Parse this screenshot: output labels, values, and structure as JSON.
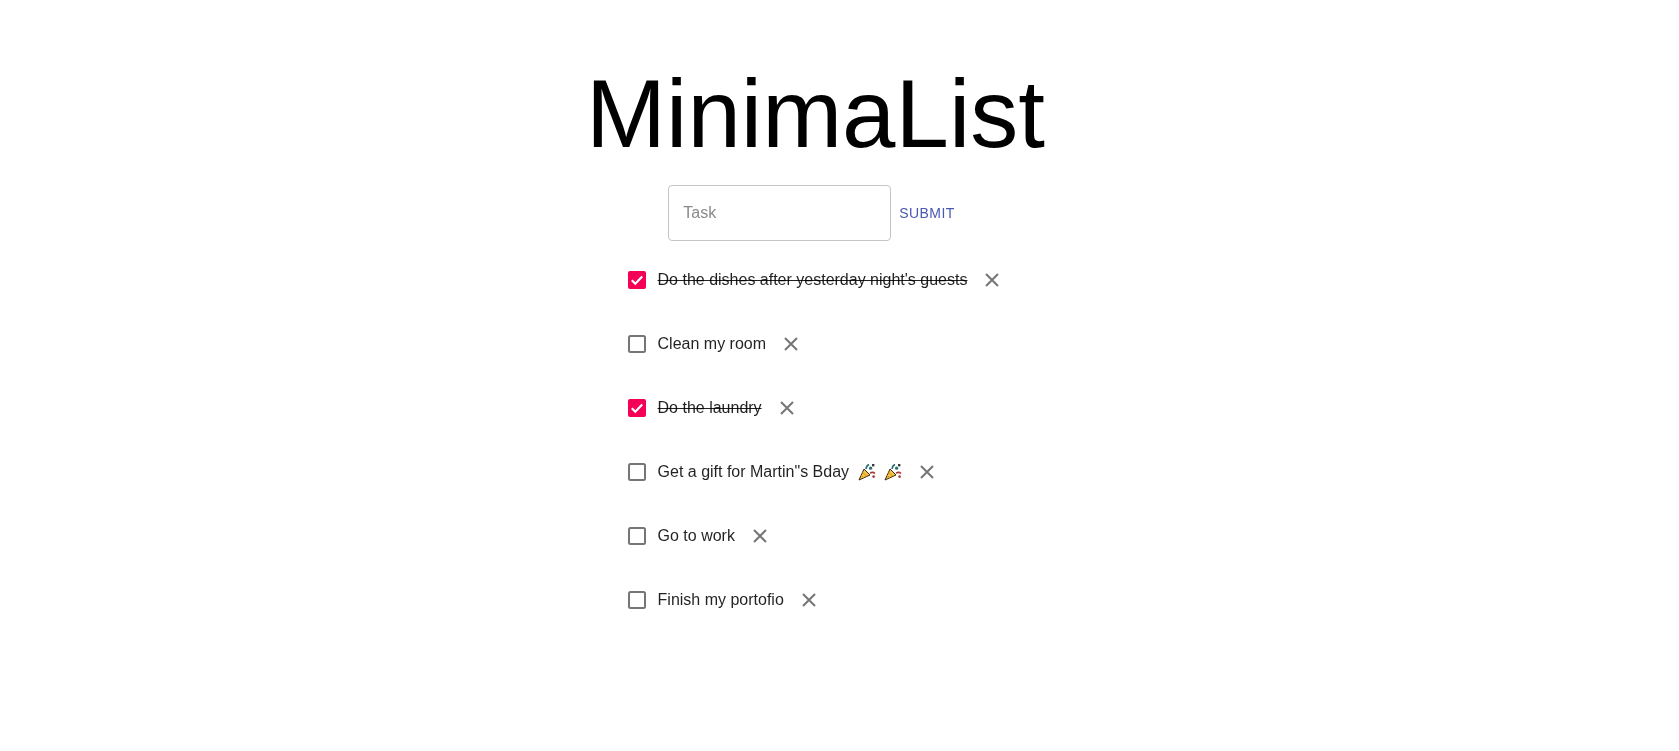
{
  "app": {
    "title": "MinimaList"
  },
  "new_task": {
    "placeholder": "Task",
    "submit": "SUBMIT"
  },
  "tasks": [
    {
      "text": "Do the dishes after yesterday night's guests",
      "checked": true
    },
    {
      "text": "Clean my room",
      "checked": false
    },
    {
      "text": "Do the laundry",
      "checked": true
    },
    {
      "text": "Get a gift for Martin\"s Bday",
      "checked": false,
      "emojis": [
        {
          "kind": "party-popper"
        },
        {
          "kind": "party-popper"
        }
      ]
    },
    {
      "text": "Go to work",
      "checked": false
    },
    {
      "text": "Finish my portofio",
      "checked": false
    }
  ]
}
